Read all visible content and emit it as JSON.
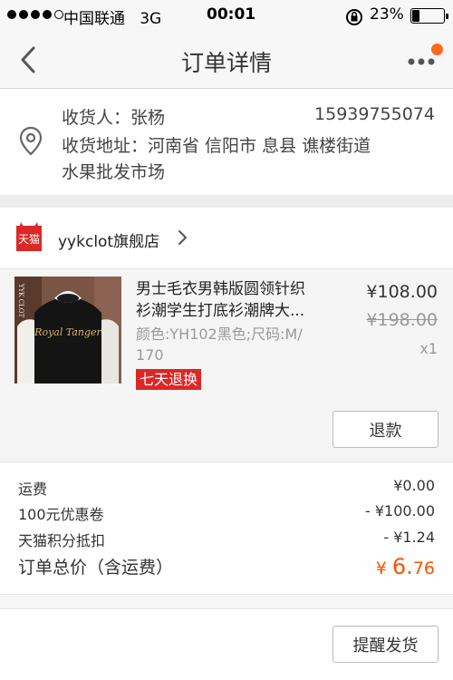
{
  "status_bar": {
    "carrier": "中国联通",
    "network": "3G",
    "time": "00:01",
    "battery_percent": "23%",
    "battery_level": 0.23
  },
  "nav": {
    "title": "订单详情",
    "back_icon": "chevron-left-icon",
    "more_icon": "more-dots-icon",
    "badge_color": "#ff6a1a"
  },
  "address": {
    "receiver_label": "收货人：张杨",
    "phone": "15939755074",
    "address_line1": "收货地址：河南省 信阳市 息县 谯楼街道",
    "address_line2": "水果批发市场"
  },
  "shop": {
    "logo_text": "天猫",
    "name": "yykclot旗舰店"
  },
  "product": {
    "name": "男士毛衣男韩版圆领针织衫潮学生打底衫潮牌大...",
    "name_line1": "男士毛衣男韩版圆领针织",
    "name_line2": "衫潮学生打底衫潮牌大...",
    "spec_line1": "颜色:YH102黑色;尺码:M/",
    "spec_line2": "170",
    "tag": "七天退换",
    "price": "¥108.00",
    "original_price": "¥198.00",
    "quantity": "x1",
    "refund_button": "退款",
    "image_brand_text": "YYK CLOT",
    "image_script_text": "Royal Tanger"
  },
  "costs": {
    "shipping_label": "运费",
    "shipping_value": "¥0.00",
    "coupon_label": "100元优惠卷",
    "coupon_value": "- ¥100.00",
    "points_label": "天猫积分抵扣",
    "points_value": "- ¥1.24",
    "total_label": "订单总价（含运费）",
    "total_currency": "¥",
    "total_int": "6.",
    "total_dec": "76"
  },
  "footer": {
    "remind_button": "提醒发货"
  },
  "colors": {
    "accent_orange": "#ff5000",
    "tmall_red": "#dd2727"
  }
}
